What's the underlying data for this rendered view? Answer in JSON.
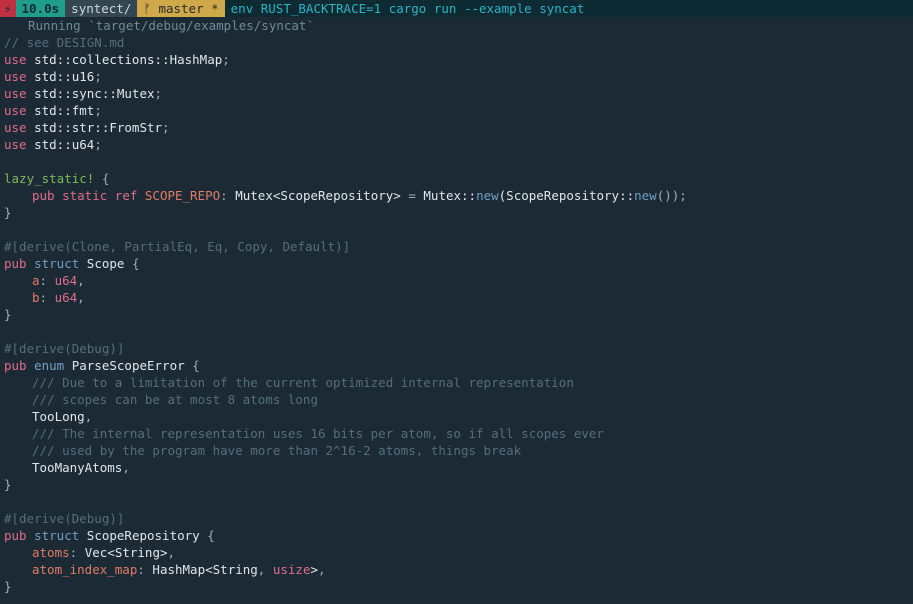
{
  "prompt": {
    "lightning": "⚡",
    "time": "10.0s",
    "dir": "syntect/",
    "branch_icon": "ᚠ",
    "branch": "master *",
    "cmd_prefix": "env",
    "cmd_rest": " RUST_BACKTRACE=1 cargo run --example syncat"
  },
  "running": "Running `target/debug/examples/syncat`",
  "lines": {
    "c1": "// see DESIGN.md",
    "use1_kw": "use",
    "use1_path": " std::collections::HashMap",
    "semi": ";",
    "use2_path": " std::u16",
    "use3_path": " std::sync::Mutex",
    "use4_path": " std::fmt",
    "use5_path": " std::str::FromStr",
    "use6_path": " std::u64",
    "lazy_macro": "lazy_static!",
    "lazy_brace": " {",
    "ls_pub": "pub",
    "ls_static": " static",
    "ls_ref": " ref ",
    "ls_name": "SCOPE_REPO",
    "ls_colon": ": ",
    "ls_type": "Mutex<ScopeRepository>",
    "ls_eq": " = ",
    "ls_call": "Mutex::",
    "ls_new": "new",
    "ls_paren": "(ScopeRepository::",
    "ls_new2": "new",
    "ls_end": "());",
    "close_brace": "}",
    "attr1": "#[derive(Clone, PartialEq, Eq, Copy, Default)]",
    "scope_pub": "pub",
    "scope_struct": " struct ",
    "scope_name": "Scope",
    "scope_ob": " {",
    "fa": "a",
    "fb": "b",
    "fcolon": ": ",
    "u64": "u64",
    "comma": ",",
    "attr2": "#[derive(Debug)]",
    "enum_pub": "pub",
    "enum_kw": " enum ",
    "enum_name": "ParseScopeError",
    "enum_ob": " {",
    "ec1": "/// Due to a limitation of the current optimized internal representation",
    "ec2": "/// scopes can be at most 8 atoms long",
    "ev1": "TooLong",
    "ec3": "/// The internal representation uses 16 bits per atom, so if all scopes ever",
    "ec4": "/// used by the program have more than 2^16-2 atoms, things break",
    "ev2": "TooManyAtoms",
    "repo_pub": "pub",
    "repo_struct": " struct ",
    "repo_name": "ScopeRepository",
    "repo_ob": " {",
    "rf1": "atoms",
    "rf1t_a": "Vec<",
    "rf1t_b": "String",
    "rf1t_c": ">",
    "rf2": "atom_index_map",
    "rf2t_a": "HashMap<",
    "rf2t_b": "String",
    "rf2t_c": ", ",
    "rf2t_d": "usize",
    "rf2t_e": ">"
  }
}
